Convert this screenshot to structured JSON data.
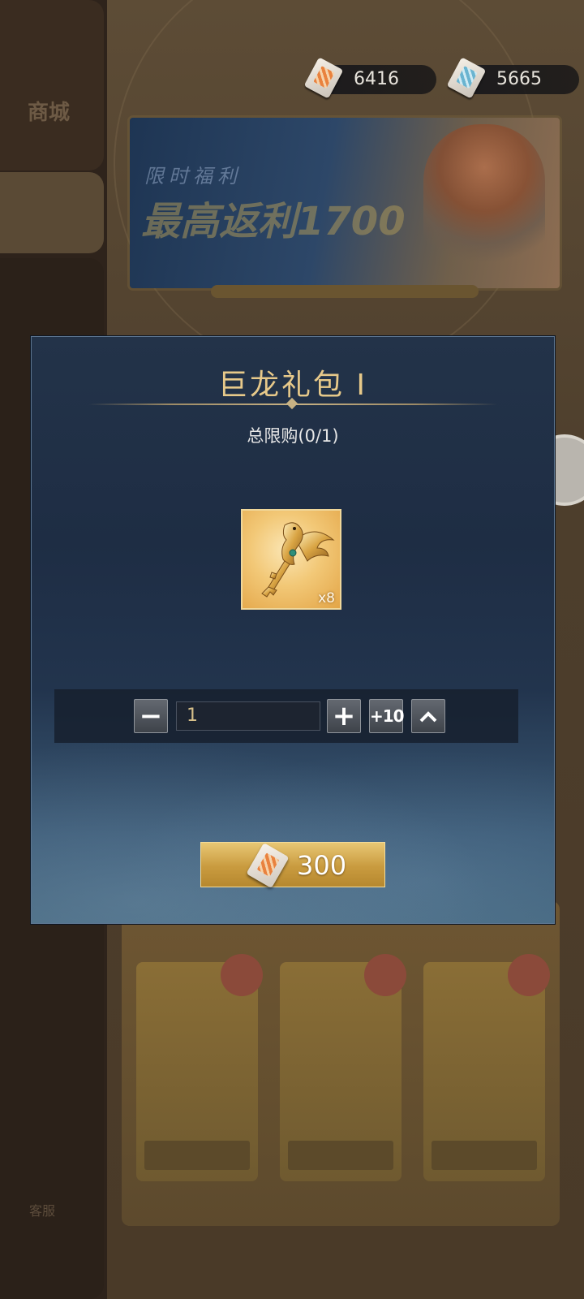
{
  "background": {
    "sidebar_label": "商城",
    "bottom_text": "客服",
    "banner_line1": "限时福利",
    "banner_line2": "最高返利1700"
  },
  "currencies": [
    {
      "icon": "orange-ticket-icon",
      "amount": "6416"
    },
    {
      "icon": "blue-ticket-icon",
      "amount": "5665"
    }
  ],
  "modal": {
    "title": "巨龙礼包 I",
    "purchase_limit": "总限购(0/1)",
    "item": {
      "icon": "golden-dragon-key-icon",
      "count": "x8"
    },
    "quantity": {
      "value": "1",
      "minus_label": "−",
      "plus_label": "+",
      "plus10_label": "+10",
      "max_label": "^"
    },
    "buy": {
      "icon": "orange-ticket-icon",
      "price": "300"
    }
  },
  "colors": {
    "title_gold": "#e7c98a",
    "modal_bg": "#233349",
    "buy_button_gold": "#c99b3f"
  }
}
